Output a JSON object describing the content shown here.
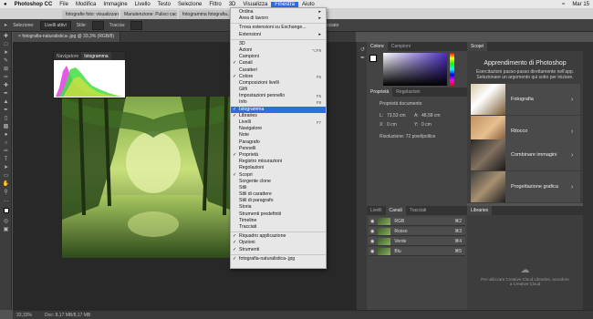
{
  "menubar": {
    "apple": "",
    "app": "Photoshop CC",
    "items": [
      "File",
      "Modifica",
      "Immagine",
      "Livello",
      "Testo",
      "Selezione",
      "Filtro",
      "3D",
      "Visualizza",
      "Finestra",
      "Aiuto"
    ],
    "active": "Finestra",
    "clock": "Mar 15"
  },
  "browser_tabs": [
    "fotografie foto: visualizzare...",
    "Manutenzione: Pulisci cache...",
    "fotogramma fotografia..."
  ],
  "options_bar": {
    "selezione": "Selezione:",
    "mode": "Livelli attivi",
    "stile": "Stile:",
    "traccia": "Traccia:",
    "hint": "Vincola trascinamento tracciato"
  },
  "doc_tab": "fotografia-naturalistica-.jpg @ 33,3% (RGB/8)",
  "histogram_panel": {
    "tabs": [
      "Navigatore",
      "Istogramma"
    ]
  },
  "window_menu": {
    "items": [
      {
        "label": "Ordina",
        "arrow": true
      },
      {
        "label": "Area di lavoro",
        "arrow": true
      },
      {
        "sep": true
      },
      {
        "label": "Trova estensioni su Exchange..."
      },
      {
        "label": "Estensioni",
        "arrow": true
      },
      {
        "sep": true
      },
      {
        "label": "3D"
      },
      {
        "label": "Azioni",
        "sc": "⌥F9"
      },
      {
        "label": "Campioni"
      },
      {
        "label": "Canali",
        "check": true
      },
      {
        "label": "Caratteri"
      },
      {
        "label": "Colore",
        "check": true,
        "sc": "F6"
      },
      {
        "label": "Composizioni livelli"
      },
      {
        "label": "Glifi"
      },
      {
        "label": "Impostazioni pennello",
        "sc": "F5"
      },
      {
        "label": "Info",
        "sc": "F8"
      },
      {
        "label": "Istogramma",
        "check": true,
        "selected": true
      },
      {
        "label": "Libraries",
        "check": true
      },
      {
        "label": "Livelli",
        "sc": "F7"
      },
      {
        "label": "Navigatore"
      },
      {
        "label": "Note"
      },
      {
        "label": "Paragrafo"
      },
      {
        "label": "Pennelli"
      },
      {
        "label": "Proprietà",
        "check": true
      },
      {
        "label": "Registro misurazioni"
      },
      {
        "label": "Regolazioni"
      },
      {
        "label": "Scopri",
        "check": true
      },
      {
        "label": "Sorgente clone"
      },
      {
        "label": "Stili"
      },
      {
        "label": "Stili di carattere"
      },
      {
        "label": "Stili di paragrafo"
      },
      {
        "label": "Storia"
      },
      {
        "label": "Strumenti predefiniti"
      },
      {
        "label": "Timeline"
      },
      {
        "label": "Tracciati"
      },
      {
        "sep": true
      },
      {
        "label": "Riquadro applicazione",
        "check": true
      },
      {
        "label": "Opzioni",
        "check": true
      },
      {
        "label": "Strumenti",
        "check": true
      },
      {
        "sep": true
      },
      {
        "label": "fotografia-naturalistica-.jpg",
        "check": true
      }
    ]
  },
  "color_panel": {
    "tabs": [
      "Colore",
      "Campioni"
    ]
  },
  "properties_panel": {
    "tabs": [
      "Proprietà",
      "Regolazioni"
    ],
    "doc": "Proprietà documento",
    "l_label": "L:",
    "l_value": "73,53 cm",
    "a_label": "A:",
    "a_value": "48,58 cm",
    "x_label": "X:",
    "x_value": "0 cm",
    "y_label": "Y:",
    "y_value": "0 cm",
    "res": "Risoluzione: 72 pixel/pollice"
  },
  "layers_panel": {
    "tabs": [
      "Livelli",
      "Canali",
      "Tracciati"
    ],
    "rows": [
      {
        "name": "RGB",
        "sc": "⌘2"
      },
      {
        "name": "Rosso",
        "sc": "⌘3"
      },
      {
        "name": "Verde",
        "sc": "⌘4"
      },
      {
        "name": "Blu",
        "sc": "⌘5"
      }
    ]
  },
  "learn_panel": {
    "tab": "Scopri",
    "title": "Apprendimento di Photoshop",
    "desc": "Esercitazioni passo-passo direttamente nell'app. Selezionare un argomento qui sotto per iniziare.",
    "cards": [
      "Fotografia",
      "Ritocco",
      "Combinare immagini",
      "Progettazione grafica"
    ]
  },
  "libraries_panel": {
    "tab": "Libraries",
    "msg": "Per utilizzare Creative Cloud Libraries, accedere a Creative Cloud"
  },
  "status": {
    "zoom": "33,33%",
    "doc": "Doc: 8,17 MB/8,17 MB"
  },
  "colors": {
    "accent": "#2f6ee0"
  }
}
